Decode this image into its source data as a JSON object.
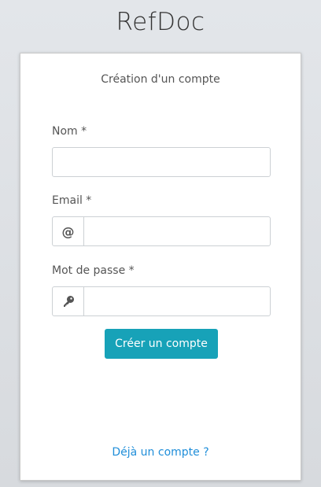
{
  "app": {
    "title": "RefDoc"
  },
  "form": {
    "title": "Création d'un compte",
    "name_label": "Nom *",
    "name_value": "",
    "email_label": "Email *",
    "email_icon": "at-icon",
    "email_icon_glyph": "@",
    "email_value": "",
    "password_label": "Mot de passe *",
    "password_icon": "key-icon",
    "password_value": "",
    "submit_label": "Créer un compte",
    "login_link": "Déjà un compte ?"
  },
  "colors": {
    "primary_button": "#17a2b8",
    "link": "#1f8ed9"
  }
}
